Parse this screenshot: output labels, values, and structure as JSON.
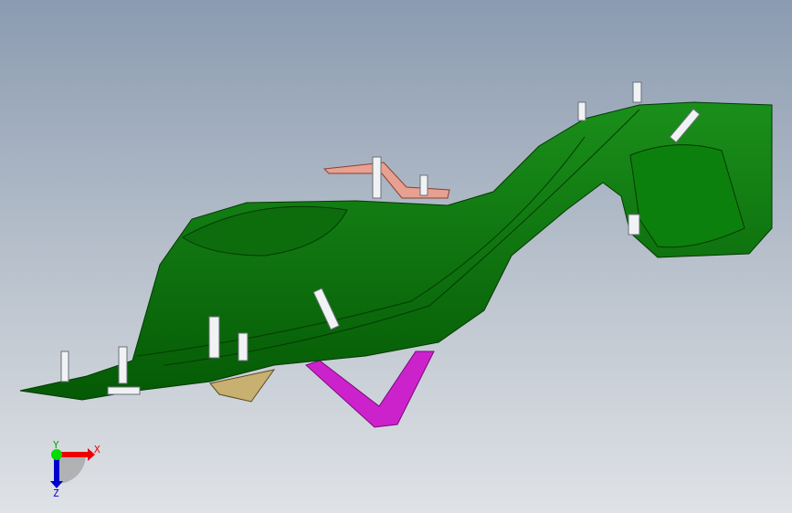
{
  "viewport": {
    "model_color": "#0a7a0a",
    "bracket_color": "#cc22cc",
    "clip_color": "#e8a090",
    "plate_color": "#c8b070"
  },
  "triad": {
    "x_label": "X",
    "y_label": "Y",
    "z_label": "Z",
    "x_color": "#ff0000",
    "y_color": "#00cc00",
    "z_color": "#0000cc"
  }
}
